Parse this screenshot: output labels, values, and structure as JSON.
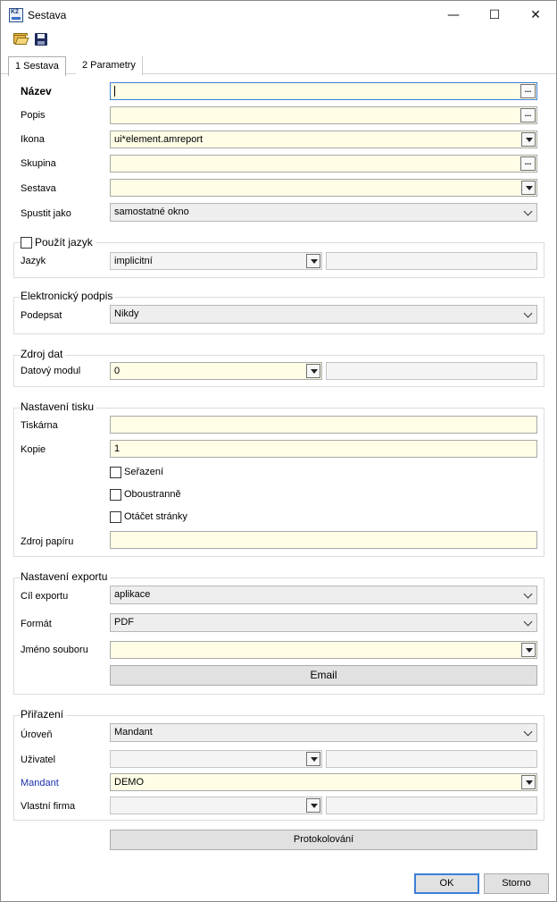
{
  "window": {
    "title": "Sestava",
    "app_icon_text": "K2",
    "controls": {
      "minimize": "—",
      "maximize": "☐",
      "close": "✕"
    }
  },
  "toolbar": {
    "icons": [
      "open-folder-icon",
      "save-icon"
    ]
  },
  "tabs": [
    {
      "label": "1 Sestava",
      "active": true
    },
    {
      "label": "2 Parametry",
      "active": false
    }
  ],
  "general": {
    "nazev_label": "Název",
    "nazev_value": "",
    "popis_label": "Popis",
    "popis_value": "",
    "ikona_label": "Ikona",
    "ikona_value": "ui*element.amreport",
    "skupina_label": "Skupina",
    "skupina_value": "",
    "sestava_label": "Sestava",
    "sestava_value": "",
    "spustit_label": "Spustit jako",
    "spustit_value": "samostatné okno",
    "ellipsis": "..."
  },
  "language": {
    "checkbox_label": "Použít jazyk",
    "checked": false,
    "jazyk_label": "Jazyk",
    "jazyk_value": "implicitní",
    "jazyk_extra": ""
  },
  "signature": {
    "title": "Elektronický podpis",
    "podepsat_label": "Podepsat",
    "podepsat_value": "Nikdy"
  },
  "datasource": {
    "title": "Zdroj dat",
    "modul_label": "Datový modul",
    "modul_value": "0",
    "modul_extra": ""
  },
  "print": {
    "title": "Nastavení tisku",
    "tiskarna_label": "Tiskárna",
    "tiskarna_value": "",
    "kopie_label": "Kopie",
    "kopie_value": "1",
    "serazeni_label": "Seřazení",
    "oboustranne_label": "Oboustranně",
    "otacet_label": "Otáčet stránky",
    "zdroj_label": "Zdroj papíru",
    "zdroj_value": ""
  },
  "export": {
    "title": "Nastavení exportu",
    "cil_label": "Cíl exportu",
    "cil_value": "aplikace",
    "format_label": "Formát",
    "format_value": "PDF",
    "soubor_label": "Jméno souboru",
    "soubor_value": "",
    "email_button": "Email"
  },
  "assignment": {
    "title": "Přiřazení",
    "uroven_label": "Úroveň",
    "uroven_value": "Mandant",
    "uzivatel_label": "Uživatel",
    "uzivatel_value": "",
    "uzivatel_extra": "",
    "mandant_label": "Mandant",
    "mandant_value": "DEMO",
    "firma_label": "Vlastní firma",
    "firma_value": "",
    "firma_extra": ""
  },
  "buttons": {
    "protokolovani": "Protokolování",
    "ok": "OK",
    "storno": "Storno"
  },
  "colors": {
    "field_yellow": "#fffde6",
    "field_grey": "#eeeeee",
    "focus_blue": "#3d7fd8",
    "mandant_label_blue": "#1a2fb0"
  }
}
